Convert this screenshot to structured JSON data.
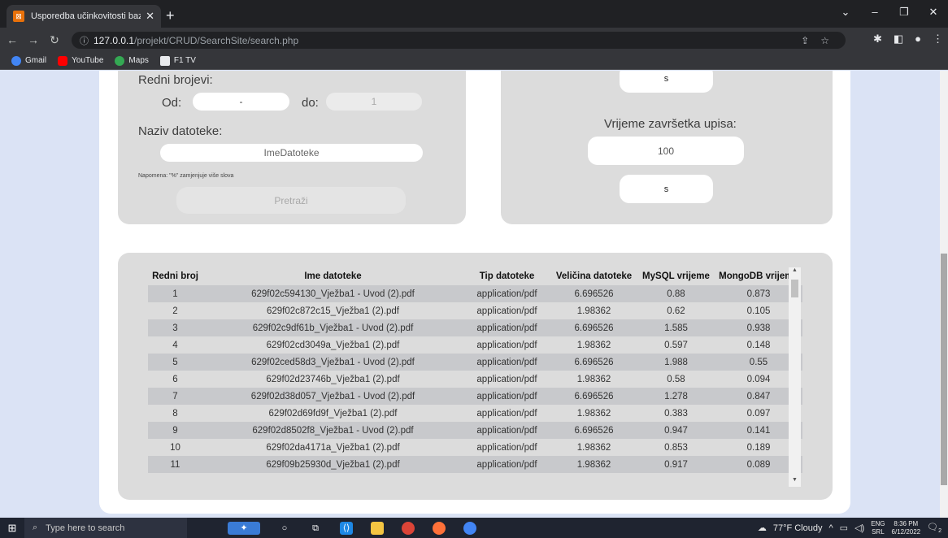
{
  "browser": {
    "tab_title": "Usporedba učinkovitosti baza",
    "url_host": "127.0.0.1",
    "url_path": "/projekt/CRUD/SearchSite/search.php",
    "bookmarks": [
      {
        "label": "Gmail",
        "color": "#4285f4"
      },
      {
        "label": "YouTube",
        "color": "#ff0000"
      },
      {
        "label": "Maps",
        "color": "#34a853"
      },
      {
        "label": "F1 TV",
        "color": "#ffffff"
      }
    ]
  },
  "form_left": {
    "range_label": "Redni brojevi:",
    "from_label": "Od:",
    "from_value": "-",
    "to_label": "do:",
    "to_placeholder": "1",
    "filename_label": "Naziv datoteke:",
    "filename_placeholder": "ImeDatoteke",
    "note": "Napomena: \"%\" zamjenjuje više slova",
    "search_button": "Pretraži"
  },
  "form_right": {
    "unit_top": "s",
    "end_time_label": "Vrijeme završetka upisa:",
    "end_time_value": "100",
    "unit_bottom": "s"
  },
  "table": {
    "headers": [
      "Redni broj",
      "Ime datoteke",
      "Tip datoteke",
      "Veličina datoteke",
      "MySQL vrijeme",
      "MongoDB vrijeme"
    ],
    "rows": [
      [
        "1",
        "629f02c594130_Vježba1 - Uvod (2).pdf",
        "application/pdf",
        "6.696526",
        "0.88",
        "0.873"
      ],
      [
        "2",
        "629f02c872c15_Vježba1 (2).pdf",
        "application/pdf",
        "1.98362",
        "0.62",
        "0.105"
      ],
      [
        "3",
        "629f02c9df61b_Vježba1 - Uvod (2).pdf",
        "application/pdf",
        "6.696526",
        "1.585",
        "0.938"
      ],
      [
        "4",
        "629f02cd3049a_Vježba1 (2).pdf",
        "application/pdf",
        "1.98362",
        "0.597",
        "0.148"
      ],
      [
        "5",
        "629f02ced58d3_Vježba1 - Uvod (2).pdf",
        "application/pdf",
        "6.696526",
        "1.988",
        "0.55"
      ],
      [
        "6",
        "629f02d23746b_Vježba1 (2).pdf",
        "application/pdf",
        "1.98362",
        "0.58",
        "0.094"
      ],
      [
        "7",
        "629f02d38d057_Vježba1 - Uvod (2).pdf",
        "application/pdf",
        "6.696526",
        "1.278",
        "0.847"
      ],
      [
        "8",
        "629f02d69fd9f_Vježba1 (2).pdf",
        "application/pdf",
        "1.98362",
        "0.383",
        "0.097"
      ],
      [
        "9",
        "629f02d8502f8_Vježba1 - Uvod (2).pdf",
        "application/pdf",
        "6.696526",
        "0.947",
        "0.141"
      ],
      [
        "10",
        "629f02da4171a_Vježba1 (2).pdf",
        "application/pdf",
        "1.98362",
        "0.853",
        "0.189"
      ],
      [
        "11",
        "629f09b25930d_Vježba1 (2).pdf",
        "application/pdf",
        "1.98362",
        "0.917",
        "0.089"
      ]
    ]
  },
  "taskbar": {
    "search_placeholder": "Type here to search",
    "weather": "77°F Cloudy",
    "lang": "ENG",
    "lang_sub": "SRL",
    "time": "8:36 PM",
    "date": "6/12/2022",
    "notification_count": "2"
  }
}
